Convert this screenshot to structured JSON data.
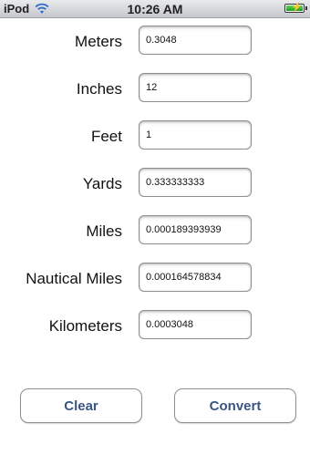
{
  "status_bar": {
    "carrier": "iPod",
    "time": "10:26 AM",
    "wifi_icon": "wifi-icon",
    "battery_icon": "battery-charging-icon"
  },
  "fields": [
    {
      "label": "Meters",
      "value": "0.3048"
    },
    {
      "label": "Inches",
      "value": "12"
    },
    {
      "label": "Feet",
      "value": "1"
    },
    {
      "label": "Yards",
      "value": "0.333333333"
    },
    {
      "label": "Miles",
      "value": "0.000189393939"
    },
    {
      "label": "Nautical Miles",
      "value": "0.000164578834"
    },
    {
      "label": "Kilometers",
      "value": "0.0003048"
    }
  ],
  "buttons": {
    "clear": "Clear",
    "convert": "Convert"
  },
  "colors": {
    "button_text": "#3a5583",
    "battery": "#3cbf37"
  }
}
